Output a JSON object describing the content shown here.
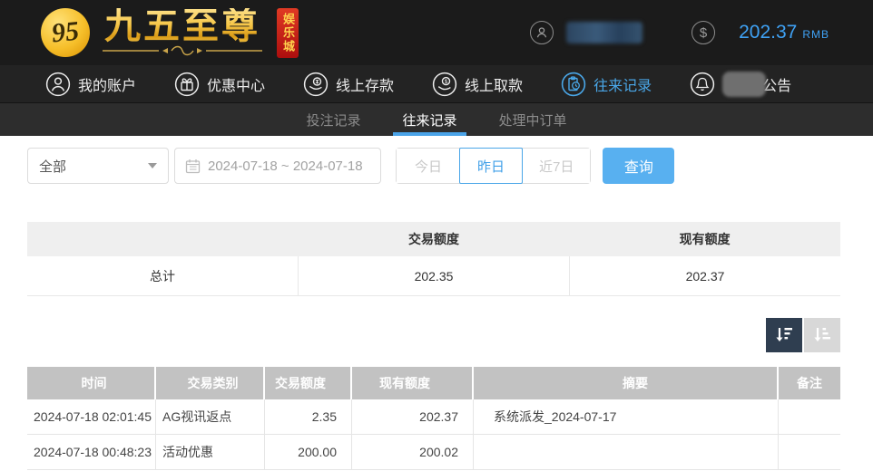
{
  "brand": {
    "logo_monogram": "95",
    "logo_title": "九五至尊",
    "logo_badge": "娱乐城"
  },
  "header": {
    "user_icon": "person-icon",
    "money_icon": "dollar-coin-icon",
    "balance": "202.37",
    "currency": "RMB"
  },
  "nav": {
    "items": [
      {
        "label": "我的账户",
        "icon": "person-icon",
        "active": false
      },
      {
        "label": "优惠中心",
        "icon": "gift-icon",
        "active": false
      },
      {
        "label": "线上存款",
        "icon": "deposit-hand-coin-icon",
        "active": false
      },
      {
        "label": "线上取款",
        "icon": "withdraw-hand-coin-icon",
        "active": false
      },
      {
        "label": "往来记录",
        "icon": "clipboard-clock-icon",
        "active": true
      },
      {
        "label": "公告",
        "icon": "bell-icon",
        "active": false,
        "censored_prefix": true
      }
    ]
  },
  "subnav": {
    "tabs": [
      {
        "label": "投注记录",
        "active": false
      },
      {
        "label": "往来记录",
        "active": true
      },
      {
        "label": "处理中订单",
        "active": false
      }
    ]
  },
  "filters": {
    "type_select_value": "全部",
    "date_range_value": "2024-07-18 ~ 2024-07-18",
    "calendar_icon": "calendar-icon",
    "quick_buttons": [
      {
        "label": "今日",
        "active": false
      },
      {
        "label": "昨日",
        "active": true
      },
      {
        "label": "近7日",
        "active": false
      }
    ],
    "search_label": "查询"
  },
  "summary": {
    "headers": {
      "col1": "",
      "col2": "交易额度",
      "col3": "现有额度"
    },
    "total_row": {
      "label": "总计",
      "trade_amount": "202.35",
      "current_amount": "202.37"
    }
  },
  "sort": {
    "descending_icon": "sort-descending-icon",
    "ascending_icon": "sort-ascending-icon"
  },
  "table": {
    "headers": [
      "时间",
      "交易类别",
      "交易额度",
      "现有额度",
      "摘要",
      "备注"
    ],
    "rows": [
      [
        "2024-07-18 02:01:45",
        "AG视讯返点",
        "2.35",
        "202.37",
        "系统派发_2024-07-17",
        ""
      ],
      [
        "2024-07-18 00:48:23",
        "活动优惠",
        "200.00",
        "200.02",
        "",
        ""
      ]
    ]
  },
  "colors": {
    "accent_blue": "#4aa6e8",
    "search_button_blue": "#58b0f0",
    "balance_blue": "#3fa2f5",
    "brand_gold": "#f5c84e",
    "badge_red": "#c01515",
    "topbar_dark": "#1b1b1b",
    "subnav_dark": "#2d2d2d",
    "table_header_gray": "#c2c2c2",
    "sort_active_dark": "#2f3e50"
  }
}
